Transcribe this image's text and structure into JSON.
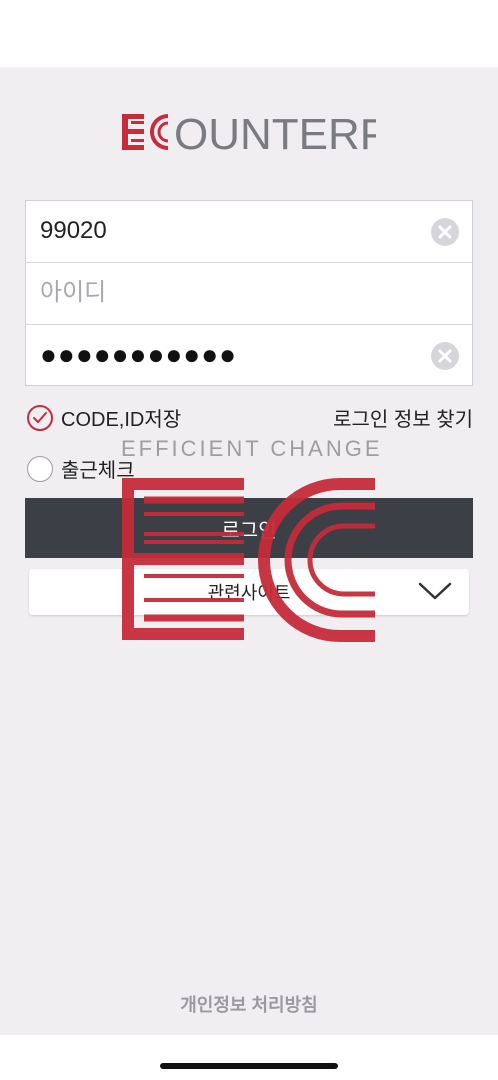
{
  "brand": {
    "logo_text": "ECOUNTERP",
    "watermark_text": "EFFICIENT CHANGE",
    "accent_color": "#c62c3a",
    "logo_gray": "#7a7b80"
  },
  "login_form": {
    "company_code_value": "99020",
    "id_placeholder": "아이디",
    "password_masked": "●●●●●●●●●●●",
    "clear_icon": "clear-icon"
  },
  "options": {
    "save_code_id_label": "CODE,ID저장",
    "save_code_id_checked": true,
    "find_login_info_label": "로그인 정보 찾기",
    "attendance_check_label": "출근체크",
    "attendance_check_checked": false
  },
  "login_button_label": "로그인",
  "related_sites": {
    "selected_label": "관련사이트",
    "icon": "chevron-down-icon"
  },
  "footer": {
    "privacy_policy_label": "개인정보 처리방침"
  }
}
